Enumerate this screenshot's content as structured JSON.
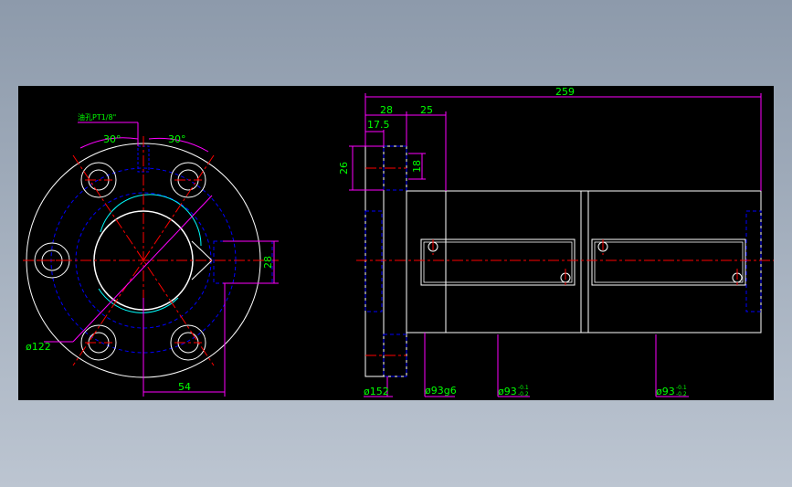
{
  "drawing": {
    "background_color": "#000000",
    "colors": {
      "outline": "#ffffff",
      "dimension": "#ff00ff",
      "text": "#00ff00",
      "centerline": "#ff0000",
      "hidden": "#0000ff",
      "bore": "#00ffff"
    },
    "front_view": {
      "label_oil_hole": "油孔PT1/8\"",
      "angle_left": "30°",
      "angle_right": "30°",
      "dim_vertical": "28",
      "dim_horizontal": "54",
      "dim_diameter": "ø122"
    },
    "side_view": {
      "dim_total": "259",
      "dim_28": "28",
      "dim_25": "25",
      "dim_17_5": "17.5",
      "dim_26": "26",
      "dim_18": "18",
      "dia_flange": "ø152",
      "dia_body": "ø93g6",
      "dia_nut1": "ø93",
      "dia_nut1_tol_upper": "-0.1",
      "dia_nut1_tol_lower": "-0.2",
      "dia_nut2": "ø93",
      "dia_nut2_tol_upper": "-0.1",
      "dia_nut2_tol_lower": "-0.2"
    }
  }
}
